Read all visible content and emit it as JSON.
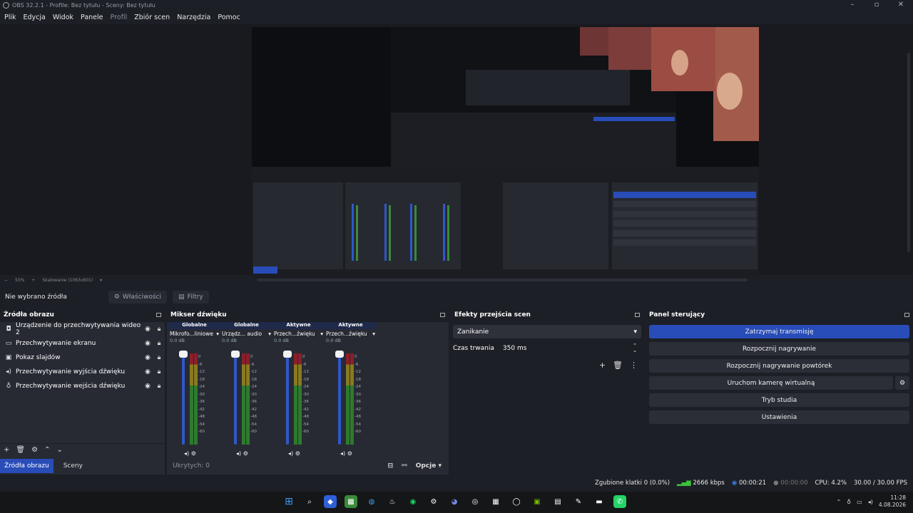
{
  "window": {
    "title": "OBS 32.2.1 - Profile: Bez tytułu - Sceny: Bez tytułu"
  },
  "menu": [
    {
      "label": "Plik",
      "enabled": true
    },
    {
      "label": "Edycja",
      "enabled": true
    },
    {
      "label": "Widok",
      "enabled": true
    },
    {
      "label": "Panele",
      "enabled": true
    },
    {
      "label": "Profil",
      "enabled": false
    },
    {
      "label": "Zbiór scen",
      "enabled": true
    },
    {
      "label": "Narzędzia",
      "enabled": true
    },
    {
      "label": "Pomoc",
      "enabled": true
    }
  ],
  "preview": {
    "zoom": "55%",
    "scale_label": "Skalowanie (1063x601)"
  },
  "context_bar": {
    "label": "Nie wybrano źródła",
    "properties": "Właściwości",
    "filters": "Filtry"
  },
  "sources": {
    "title": "Źródła obrazu",
    "items": [
      {
        "icon": "camera-icon",
        "name": "Urządzenie do przechwytywania wideo 2"
      },
      {
        "icon": "monitor-icon",
        "name": "Przechwytywanie ekranu"
      },
      {
        "icon": "slideshow-icon",
        "name": "Pokaz slajdów"
      },
      {
        "icon": "speaker-icon",
        "name": "Przechwytywanie wyjścia dźwięku"
      },
      {
        "icon": "microphone-icon",
        "name": "Przechwytywanie wejścia dźwięku"
      }
    ],
    "tabs": [
      "Źródła obrazu",
      "Sceny"
    ]
  },
  "mixer": {
    "title": "Mikser dźwięku",
    "channels": [
      {
        "tag": "Globalne",
        "name": "Mikrofo...liniowe",
        "db": "0.0 dB",
        "volume": 1.0
      },
      {
        "tag": "Globalne",
        "name": "Urządz... audio",
        "db": "0.0 dB",
        "volume": 1.0
      },
      {
        "tag": "Aktywne",
        "name": "Przech...źwięku",
        "db": "0.0 dB",
        "volume": 1.0
      },
      {
        "tag": "Aktywne",
        "name": "Przech...źwięku",
        "db": "0.0 dB",
        "volume": 1.0
      }
    ],
    "scale": [
      "0",
      "-6",
      "-12",
      "-18",
      "-24",
      "-30",
      "-36",
      "-42",
      "-48",
      "-54",
      "-60"
    ],
    "hidden": "Ukrytych: 0",
    "options": "Opcje"
  },
  "transitions": {
    "title": "Efekty przejścia scen",
    "selected": "Zanikanie",
    "duration_label": "Czas trwania",
    "duration": "350 ms"
  },
  "controls": {
    "title": "Panel sterujący",
    "buttons": [
      "Zatrzymaj transmisję",
      "Rozpocznij nagrywanie",
      "Rozpocznij nagrywanie powtórek",
      "Uruchom kamerę wirtualną",
      "Tryb studia",
      "Ustawienia"
    ]
  },
  "status": {
    "dropped": "Zgubione klatki 0 (0.0%)",
    "bitrate": "2666 kbps",
    "stream_time": "00:00:21",
    "rec_time": "00:00:00",
    "cpu": "CPU: 4.2%",
    "fps": "30.00 / 30.00 FPS"
  },
  "taskbar": {
    "time": "11:28",
    "date": "4.08.2026"
  },
  "colors": {
    "accent": "#284cb8",
    "panel": "#272a33",
    "bg": "#1d1f26"
  }
}
